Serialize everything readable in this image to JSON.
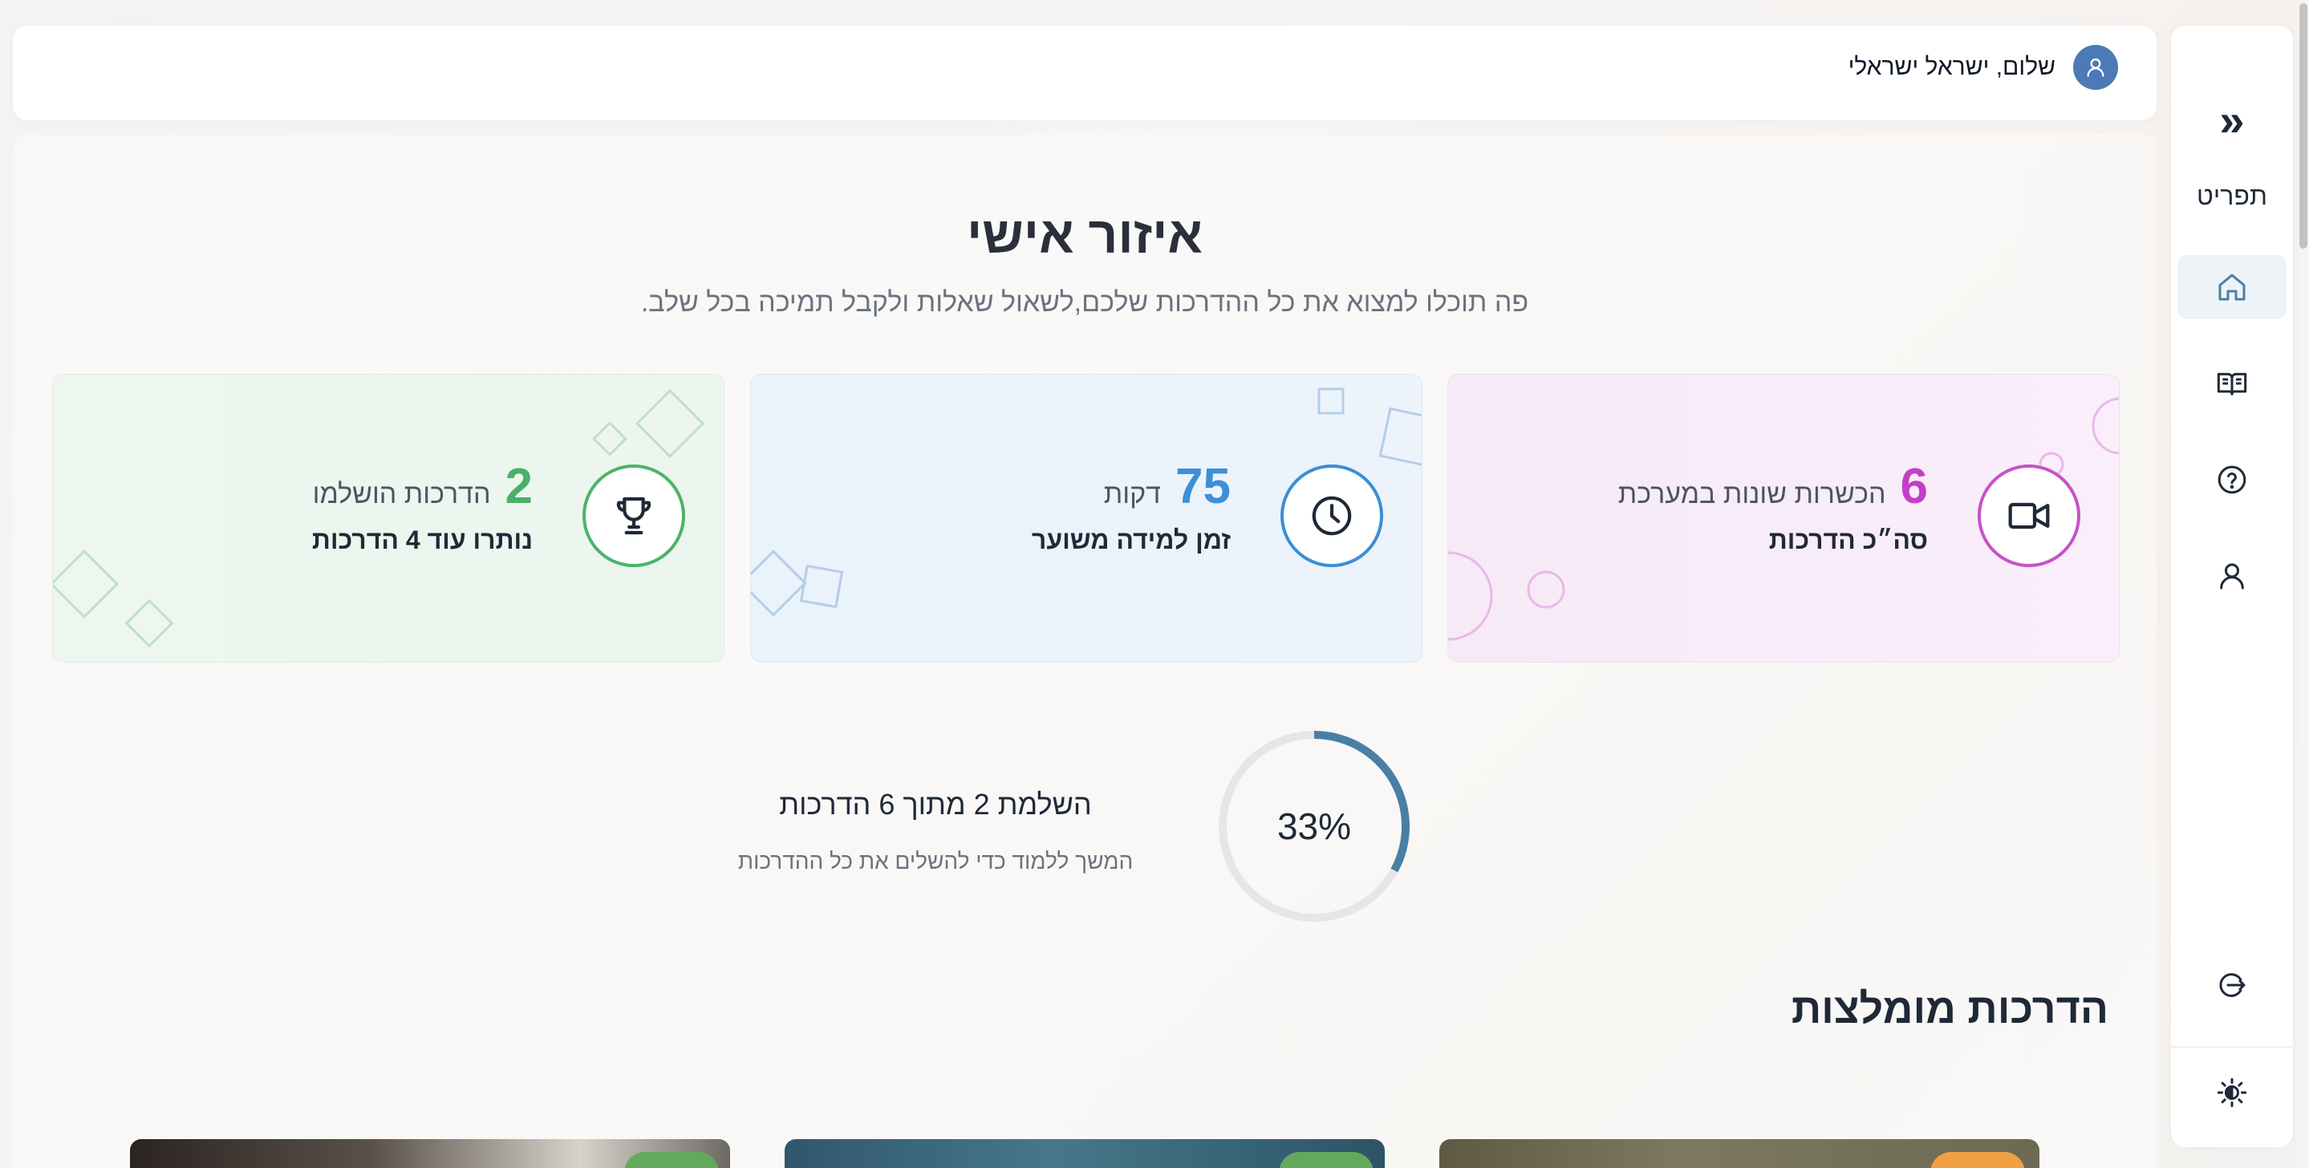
{
  "sidebar": {
    "collapse_label": "«",
    "menu_label": "תפריט",
    "items": [
      {
        "name": "home",
        "icon": "home-icon",
        "active": true
      },
      {
        "name": "guides",
        "icon": "book-icon",
        "active": false
      },
      {
        "name": "help",
        "icon": "question-icon",
        "active": false
      },
      {
        "name": "profile",
        "icon": "user-icon",
        "active": false
      }
    ],
    "logout_icon": "logout-icon",
    "theme_icon": "theme-toggle-icon"
  },
  "header": {
    "greeting": "שלום, ישראל ישראלי",
    "avatar_icon": "user-icon"
  },
  "main": {
    "title": "איזור אישי",
    "subtitle": "פה תוכלו למצוא את כל ההדרכות שלכם,לשאול שאלות ולקבל תמיכה בכל שלב."
  },
  "stats": [
    {
      "number": "6",
      "label": "הכשרות שונות במערכת",
      "sub": "סה״כ הדרכות",
      "icon": "video-camera-icon",
      "color": "#c43fc6"
    },
    {
      "number": "75",
      "label": "דקות",
      "sub": "זמן למידה משוער",
      "icon": "clock-icon",
      "color": "#3d8fd7"
    },
    {
      "number": "2",
      "label": "הדרכות הושלמו",
      "sub": "נותרו עוד 4 הדרכות",
      "icon": "trophy-icon",
      "color": "#4caf69"
    }
  ],
  "progress": {
    "percent_label": "33%",
    "fraction": 0.33,
    "title": "השלמת 2 מתוך 6 הדרכות",
    "subtitle": "המשך ללמוד כדי להשלים את כל ההדרכות",
    "color": "#4a7fa5"
  },
  "recommended": {
    "title": "הדרכות מומלצות",
    "badge_colors": [
      "#f0a042",
      "#64a85c",
      "#64a85c"
    ]
  }
}
